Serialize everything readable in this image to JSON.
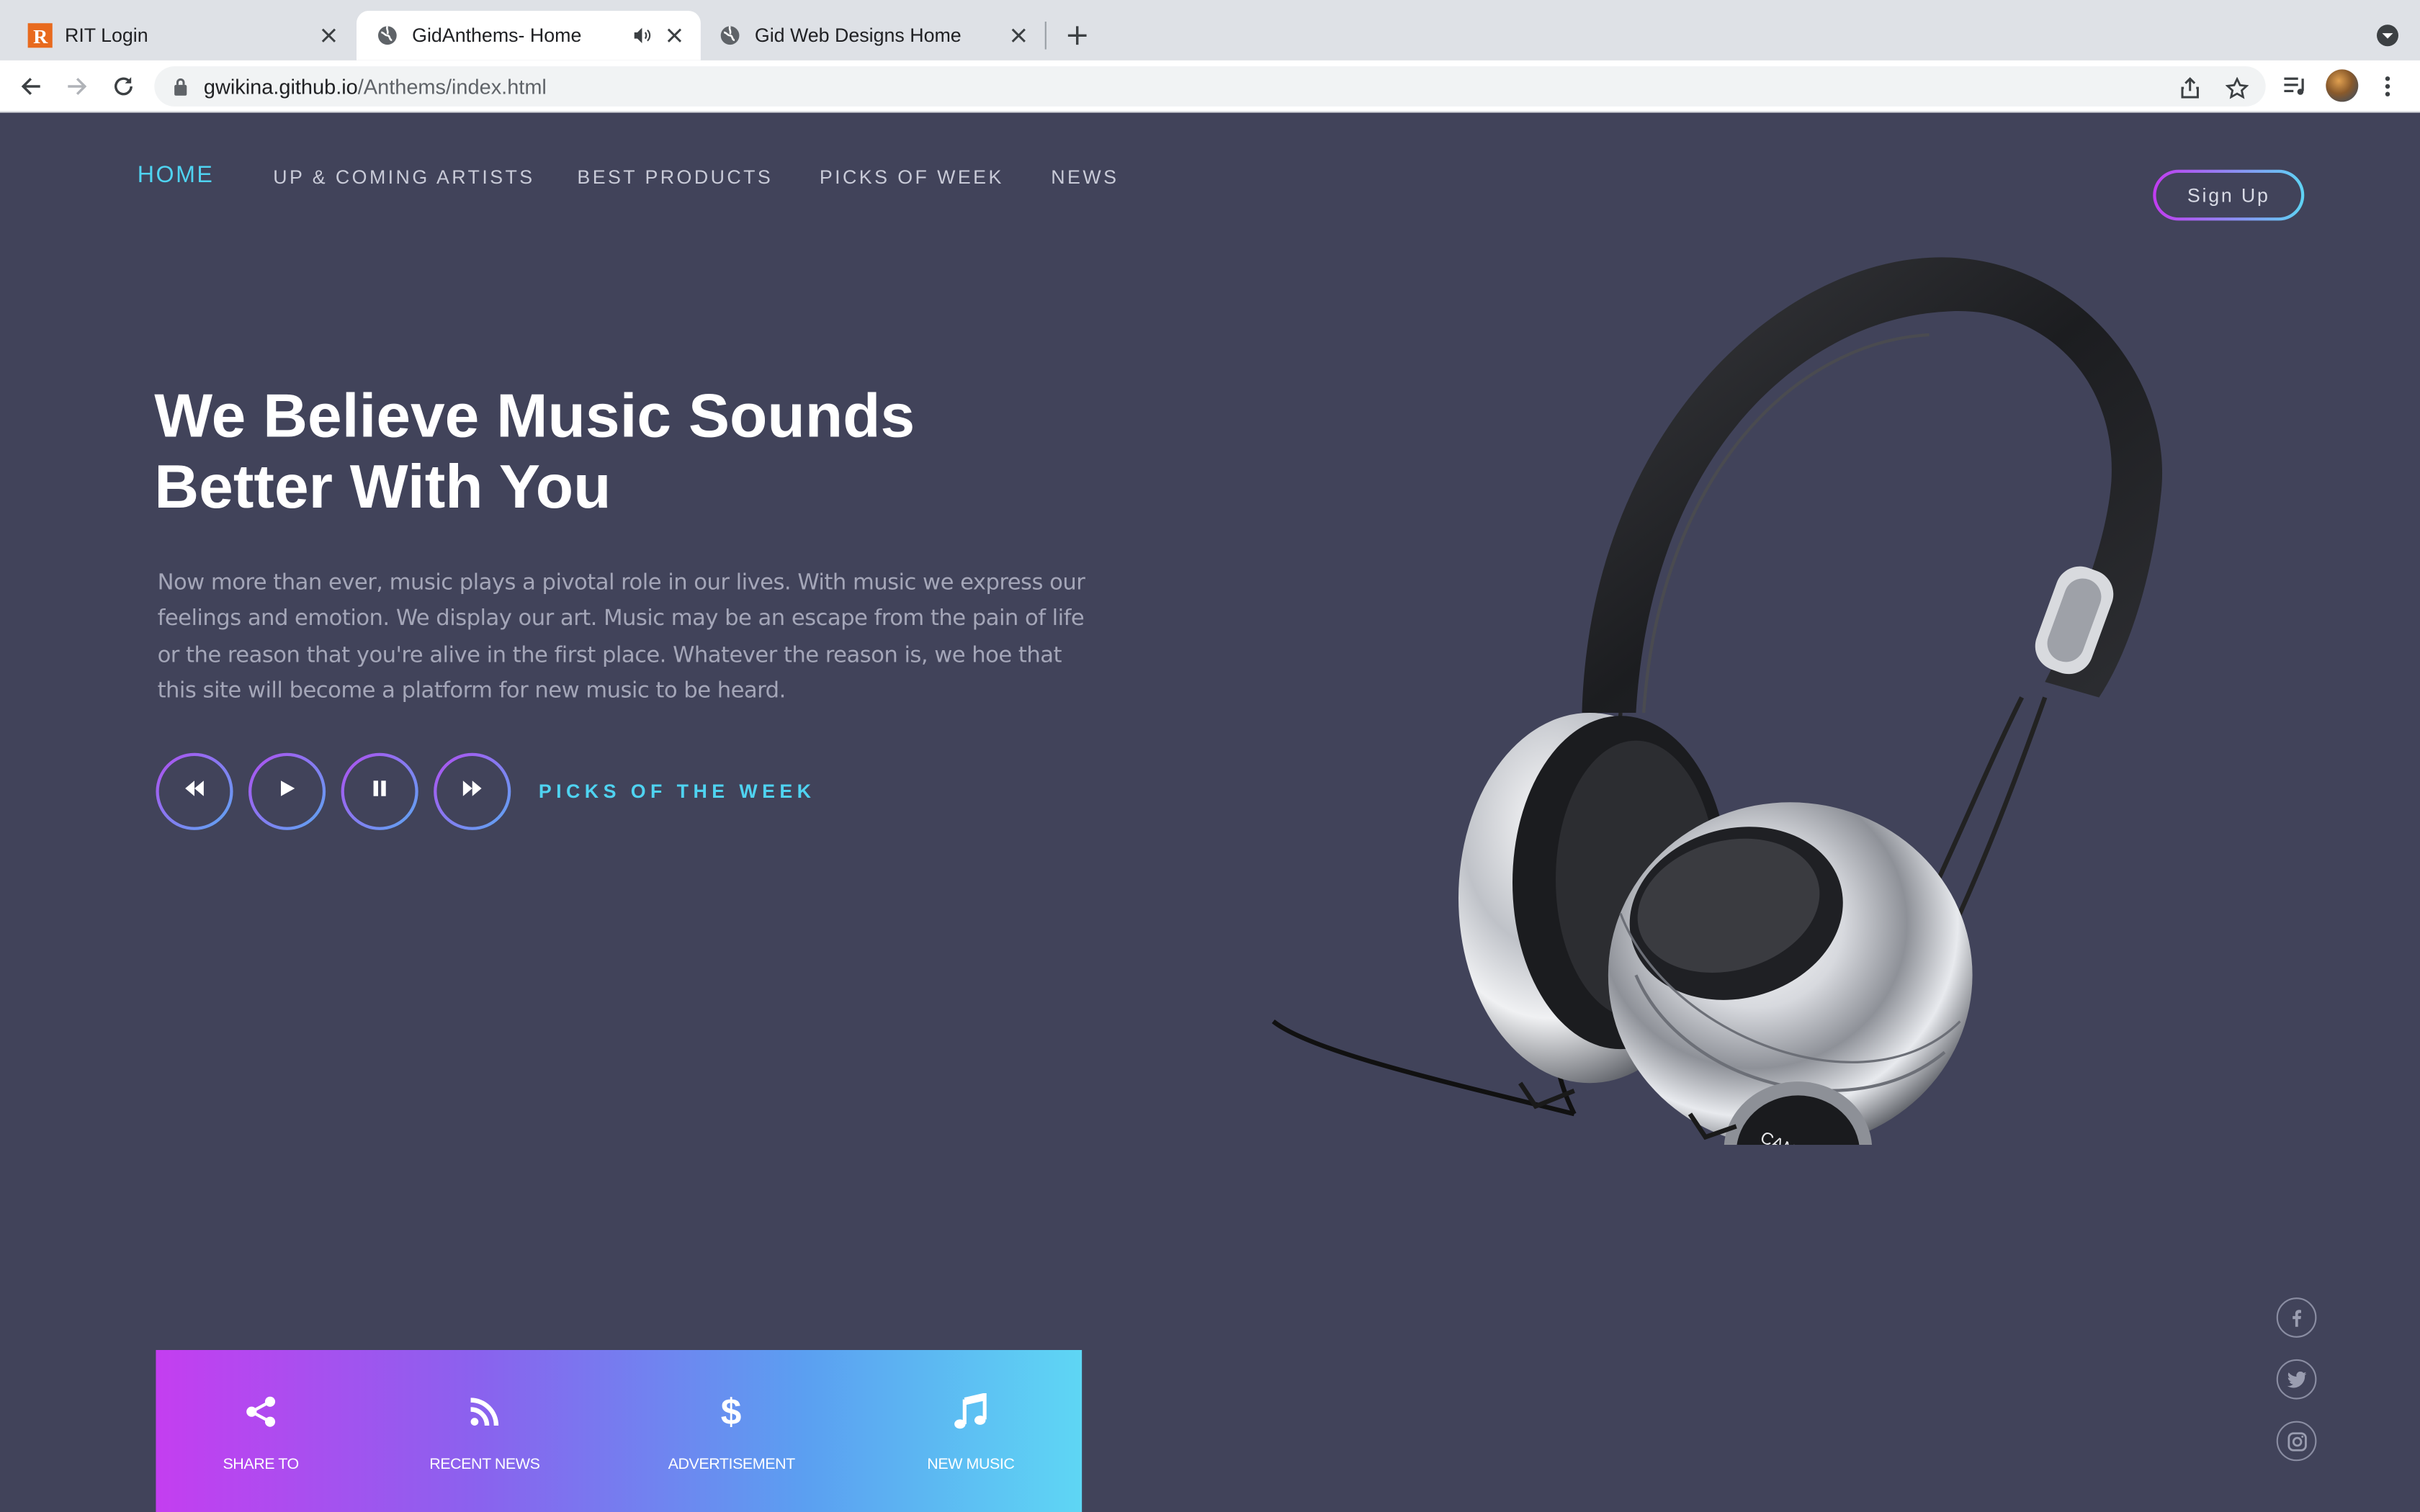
{
  "browser": {
    "tabs": [
      {
        "title": "RIT Login",
        "favicon": "rit-logo-icon",
        "active": false
      },
      {
        "title": "GidAnthems- Home",
        "favicon": "globe-icon",
        "active": true,
        "audio": true
      },
      {
        "title": "Gid Web Designs Home",
        "favicon": "globe-icon",
        "active": false
      }
    ],
    "url_host": "gwikina.github.io",
    "url_path": "/Anthems/index.html"
  },
  "nav": {
    "items": [
      "HOME",
      "UP & COMING ARTISTS",
      "BEST PRODUCTS",
      "PICKS OF WEEK",
      "NEWS"
    ],
    "active": "HOME",
    "signup_label": "Sign Up"
  },
  "hero": {
    "title_line1": "We Believe Music Sounds",
    "title_line2": "Better With You",
    "paragraph": "Now more than ever, music plays a pivotal role in our lives. With music we express our feelings and emotion. We display our art. Music may be an escape from the pain of life or the reason that you're alive in the first place. Whatever the reason is, we hoe that this site will become a platform for new music to be heard.",
    "player_controls": [
      "rewind-icon",
      "play-icon",
      "pause-icon",
      "fast-forward-icon"
    ],
    "picks_label": "PICKS OF THE WEEK"
  },
  "product_image": {
    "brand": "CANYON"
  },
  "social": [
    "facebook-icon",
    "twitter-icon",
    "instagram-icon"
  ],
  "features": [
    {
      "icon": "share-icon",
      "label": "SHARE TO"
    },
    {
      "icon": "rss-icon",
      "label": "RECENT NEWS"
    },
    {
      "icon": "dollar-icon",
      "label": "ADVERTISEMENT"
    },
    {
      "icon": "music-note-icon",
      "label": "NEW MUSIC"
    }
  ],
  "colors": {
    "page_bg": "#41435a",
    "accent_cyan": "#4fd3f1",
    "gradient_start": "#c43ef0",
    "gradient_end": "#5ed6f4"
  }
}
